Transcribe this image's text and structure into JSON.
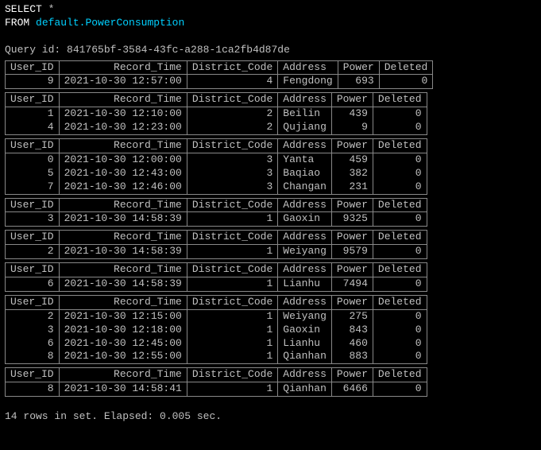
{
  "sql": {
    "select_kw": "SELECT",
    "star": "*",
    "from_kw": "FROM",
    "table": "default.PowerConsumption"
  },
  "query_id_label": "Query id:",
  "query_id": "841765bf-3584-43fc-a288-1ca2fb4d87de",
  "columns": [
    "User_ID",
    "Record_Time",
    "District_Code",
    "Address",
    "Power",
    "Deleted"
  ],
  "blocks": [
    {
      "rows": [
        {
          "User_ID": "9",
          "Record_Time": "2021-10-30 12:57:00",
          "District_Code": "4",
          "Address": "Fengdong",
          "Power": "693",
          "Deleted": "0"
        }
      ]
    },
    {
      "rows": [
        {
          "User_ID": "1",
          "Record_Time": "2021-10-30 12:10:00",
          "District_Code": "2",
          "Address": "Beilin",
          "Power": "439",
          "Deleted": "0"
        },
        {
          "User_ID": "4",
          "Record_Time": "2021-10-30 12:23:00",
          "District_Code": "2",
          "Address": "Qujiang",
          "Power": "9",
          "Deleted": "0"
        }
      ]
    },
    {
      "rows": [
        {
          "User_ID": "0",
          "Record_Time": "2021-10-30 12:00:00",
          "District_Code": "3",
          "Address": "Yanta",
          "Power": "459",
          "Deleted": "0"
        },
        {
          "User_ID": "5",
          "Record_Time": "2021-10-30 12:43:00",
          "District_Code": "3",
          "Address": "Baqiao",
          "Power": "382",
          "Deleted": "0"
        },
        {
          "User_ID": "7",
          "Record_Time": "2021-10-30 12:46:00",
          "District_Code": "3",
          "Address": "Changan",
          "Power": "231",
          "Deleted": "0"
        }
      ]
    },
    {
      "rows": [
        {
          "User_ID": "3",
          "Record_Time": "2021-10-30 14:58:39",
          "District_Code": "1",
          "Address": "Gaoxin",
          "Power": "9325",
          "Deleted": "0"
        }
      ]
    },
    {
      "rows": [
        {
          "User_ID": "2",
          "Record_Time": "2021-10-30 14:58:39",
          "District_Code": "1",
          "Address": "Weiyang",
          "Power": "9579",
          "Deleted": "0"
        }
      ]
    },
    {
      "rows": [
        {
          "User_ID": "6",
          "Record_Time": "2021-10-30 14:58:39",
          "District_Code": "1",
          "Address": "Lianhu",
          "Power": "7494",
          "Deleted": "0"
        }
      ]
    },
    {
      "rows": [
        {
          "User_ID": "2",
          "Record_Time": "2021-10-30 12:15:00",
          "District_Code": "1",
          "Address": "Weiyang",
          "Power": "275",
          "Deleted": "0"
        },
        {
          "User_ID": "3",
          "Record_Time": "2021-10-30 12:18:00",
          "District_Code": "1",
          "Address": "Gaoxin",
          "Power": "843",
          "Deleted": "0"
        },
        {
          "User_ID": "6",
          "Record_Time": "2021-10-30 12:45:00",
          "District_Code": "1",
          "Address": "Lianhu",
          "Power": "460",
          "Deleted": "0"
        },
        {
          "User_ID": "8",
          "Record_Time": "2021-10-30 12:55:00",
          "District_Code": "1",
          "Address": "Qianhan",
          "Power": "883",
          "Deleted": "0"
        }
      ]
    },
    {
      "rows": [
        {
          "User_ID": "8",
          "Record_Time": "2021-10-30 14:58:41",
          "District_Code": "1",
          "Address": "Qianhan",
          "Power": "6466",
          "Deleted": "0"
        }
      ]
    }
  ],
  "footer": "14 rows in set. Elapsed: 0.005 sec."
}
